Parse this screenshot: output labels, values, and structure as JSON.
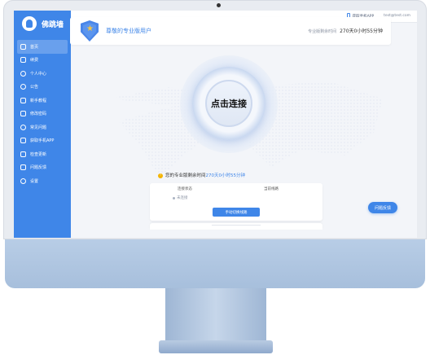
{
  "brand": {
    "name": "佛跳墙"
  },
  "sidebar": {
    "items": [
      {
        "label": "首页",
        "icon": "home-icon",
        "active": true
      },
      {
        "label": "续费",
        "icon": "renew-icon"
      },
      {
        "label": "个人中心",
        "icon": "user-icon"
      },
      {
        "label": "公告",
        "icon": "bell-icon"
      },
      {
        "label": "新手教程",
        "icon": "book-icon"
      },
      {
        "label": "修改密码",
        "icon": "edit-icon"
      },
      {
        "label": "常见问题",
        "icon": "question-icon"
      },
      {
        "label": "获取手机APP",
        "icon": "phone-icon"
      },
      {
        "label": "检查更新",
        "icon": "update-icon"
      },
      {
        "label": "问题反馈",
        "icon": "feedback-icon"
      },
      {
        "label": "设置",
        "icon": "gear-icon"
      }
    ]
  },
  "topbar": {
    "app_link": "获取手机APP",
    "email": "test@test.com"
  },
  "user_card": {
    "title": "尊敬的专业版用户",
    "remain_label": "专业版剩余时间",
    "remain_value": "270天0小时55分钟"
  },
  "connect": {
    "label": "点击连接"
  },
  "expiry": {
    "prefix": "您的专业版剩余时间",
    "value": "270天0小时55分钟"
  },
  "status": {
    "conn_label": "连接状态",
    "line_label": "当前线路",
    "conn_value": "未连接",
    "switch_button": "手动切换线路"
  },
  "feedback_button": "问题反馈",
  "colors": {
    "accent": "#3f86e8",
    "warning": "#f4b400",
    "star": "#f6c543"
  }
}
